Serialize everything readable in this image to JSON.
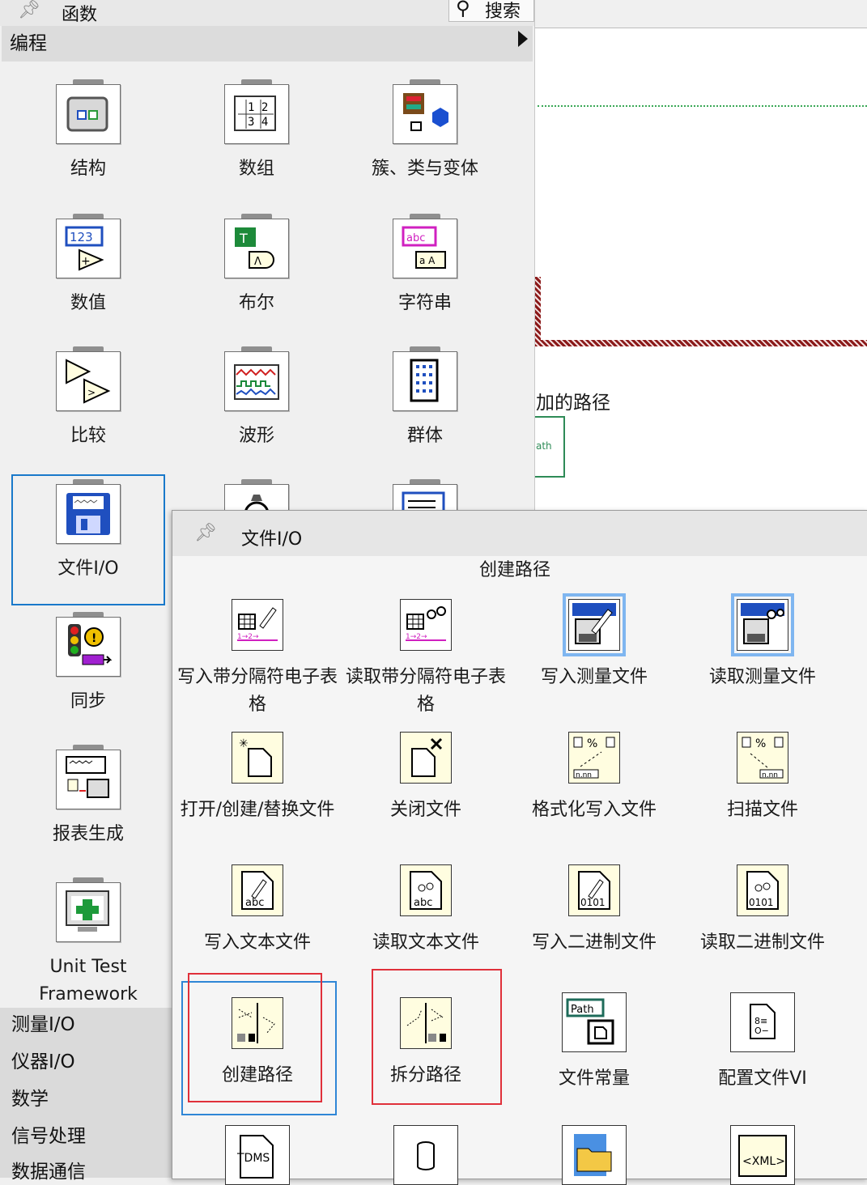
{
  "palette": {
    "title": "函数",
    "search_label": "搜索",
    "category": "编程",
    "items": [
      {
        "label": "结构",
        "icon": "structures-icon"
      },
      {
        "label": "数组",
        "icon": "array-icon"
      },
      {
        "label": "簇、类与变体",
        "icon": "cluster-class-variant-icon"
      },
      {
        "label": "数值",
        "icon": "numeric-icon"
      },
      {
        "label": "布尔",
        "icon": "boolean-icon"
      },
      {
        "label": "字符串",
        "icon": "string-icon"
      },
      {
        "label": "比较",
        "icon": "comparison-icon"
      },
      {
        "label": "波形",
        "icon": "waveform-icon"
      },
      {
        "label": "群体",
        "icon": "collection-icon"
      },
      {
        "label": "文件I/O",
        "icon": "file-io-icon"
      },
      {
        "label": "同步",
        "icon": "synchronization-icon"
      },
      {
        "label": "报表生成",
        "icon": "report-generation-icon"
      },
      {
        "label": "Unit Test Framework",
        "icon": "unit-test-icon"
      }
    ],
    "other_categories": [
      "测量I/O",
      "仪器I/O",
      "数学",
      "信号处理",
      "数据通信"
    ]
  },
  "subpalette": {
    "title": "文件I/O",
    "hover_name": "创建路径",
    "items": [
      {
        "label": "写入带分隔符电子表格",
        "icon": "write-delimited-spreadsheet-icon"
      },
      {
        "label": "读取带分隔符电子表格",
        "icon": "read-delimited-spreadsheet-icon"
      },
      {
        "label": "写入测量文件",
        "icon": "write-measurement-file-icon"
      },
      {
        "label": "读取测量文件",
        "icon": "read-measurement-file-icon"
      },
      {
        "label": "打开/创建/替换文件",
        "icon": "open-create-replace-file-icon"
      },
      {
        "label": "关闭文件",
        "icon": "close-file-icon"
      },
      {
        "label": "格式化写入文件",
        "icon": "format-into-file-icon"
      },
      {
        "label": "扫描文件",
        "icon": "scan-from-file-icon"
      },
      {
        "label": "写入文本文件",
        "icon": "write-text-file-icon"
      },
      {
        "label": "读取文本文件",
        "icon": "read-text-file-icon"
      },
      {
        "label": "写入二进制文件",
        "icon": "write-binary-file-icon"
      },
      {
        "label": "读取二进制文件",
        "icon": "read-binary-file-icon"
      },
      {
        "label": "创建路径",
        "icon": "build-path-icon"
      },
      {
        "label": "拆分路径",
        "icon": "strip-path-icon"
      },
      {
        "label": "文件常量",
        "icon": "file-constants-icon"
      },
      {
        "label": "配置文件VI",
        "icon": "config-file-vis-icon"
      }
    ],
    "bottom_icons": [
      "tdms-icon",
      "storage-icon",
      "advanced-file-functions-icon",
      "xml-icon"
    ]
  },
  "diagram": {
    "path_label_fragment": "加的路径",
    "path_const_fragment": "ath"
  },
  "colors": {
    "selection_blue": "#1979ca",
    "annotation_red": "#e0303a",
    "highlight_blue": "#7fb6f0"
  }
}
